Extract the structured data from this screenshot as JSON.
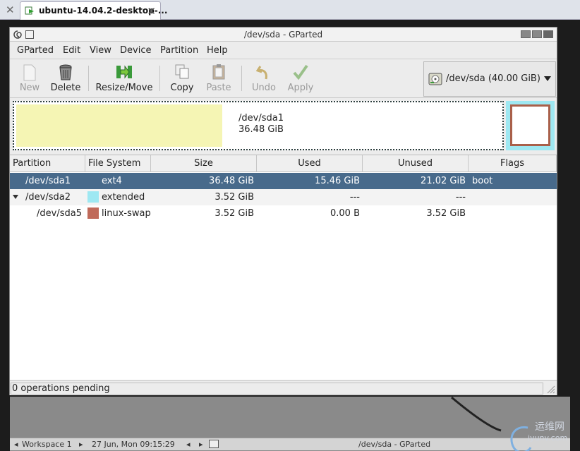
{
  "host_tab": {
    "title": "ubuntu-14.04.2-desktop-...",
    "close": "✕"
  },
  "host_left_close": "✕",
  "window": {
    "title": "/dev/sda - GParted"
  },
  "menu": [
    "GParted",
    "Edit",
    "View",
    "Device",
    "Partition",
    "Help"
  ],
  "toolbar": {
    "new": "New",
    "delete": "Delete",
    "resize": "Resize/Move",
    "copy": "Copy",
    "paste": "Paste",
    "undo": "Undo",
    "apply": "Apply"
  },
  "device_selector": {
    "label": "/dev/sda  (40.00 GiB)"
  },
  "disk_map": {
    "partition_name": "/dev/sda1",
    "partition_size": "36.48 GiB",
    "used_fraction": 0.42
  },
  "table": {
    "headers": [
      "Partition",
      "File System",
      "Size",
      "Used",
      "Unused",
      "Flags"
    ],
    "rows": [
      {
        "partition": "/dev/sda1",
        "fs": "ext4",
        "size": "36.48 GiB",
        "used": "15.46 GiB",
        "unused": "21.02 GiB",
        "flags": "boot",
        "color": "#486a8b"
      },
      {
        "partition": "/dev/sda2",
        "fs": "extended",
        "size": "3.52 GiB",
        "used": "---",
        "unused": "---",
        "flags": "",
        "color": "#9ee8f2"
      },
      {
        "partition": "/dev/sda5",
        "fs": "linux-swap",
        "size": "3.52 GiB",
        "used": "0.00 B",
        "unused": "3.52 GiB",
        "flags": "",
        "color": "#c06a5a"
      }
    ]
  },
  "status": "0 operations pending",
  "panel": {
    "workspace": "Workspace 1",
    "datetime": "27 Jun, Mon 09:15:29",
    "task": "/dev/sda - GParted",
    "left_arrow": "◂",
    "right_arrow": "▸"
  },
  "watermark": {
    "line1": "运维网",
    "line2": "iyunv.com"
  }
}
